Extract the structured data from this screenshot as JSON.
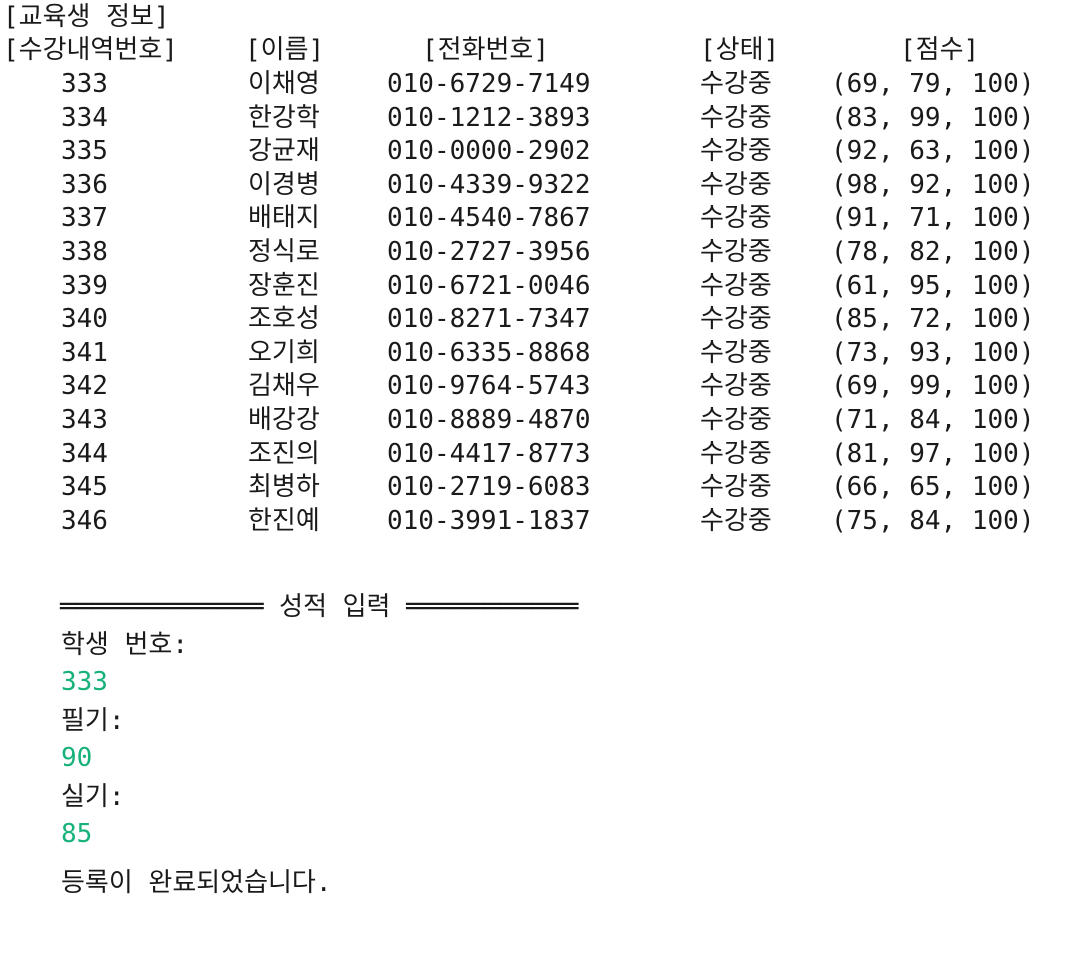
{
  "section_title": "[교육생 정보]",
  "columns": {
    "record_no": "[수강내역번호]",
    "name": "[이름]",
    "phone": "[전화번호]",
    "status": "[상태]",
    "score": "[점수]"
  },
  "rows": [
    {
      "no": "333",
      "name": "이채영",
      "phone": "010-6729-7149",
      "status": "수강중",
      "score": "(69, 79, 100)"
    },
    {
      "no": "334",
      "name": "한강학",
      "phone": "010-1212-3893",
      "status": "수강중",
      "score": "(83, 99, 100)"
    },
    {
      "no": "335",
      "name": "강균재",
      "phone": "010-0000-2902",
      "status": "수강중",
      "score": "(92, 63, 100)"
    },
    {
      "no": "336",
      "name": "이경병",
      "phone": "010-4339-9322",
      "status": "수강중",
      "score": "(98, 92, 100)"
    },
    {
      "no": "337",
      "name": "배태지",
      "phone": "010-4540-7867",
      "status": "수강중",
      "score": "(91, 71, 100)"
    },
    {
      "no": "338",
      "name": "정식로",
      "phone": "010-2727-3956",
      "status": "수강중",
      "score": "(78, 82, 100)"
    },
    {
      "no": "339",
      "name": "장훈진",
      "phone": "010-6721-0046",
      "status": "수강중",
      "score": "(61, 95, 100)"
    },
    {
      "no": "340",
      "name": "조호성",
      "phone": "010-8271-7347",
      "status": "수강중",
      "score": "(85, 72, 100)"
    },
    {
      "no": "341",
      "name": "오기희",
      "phone": "010-6335-8868",
      "status": "수강중",
      "score": "(73, 93, 100)"
    },
    {
      "no": "342",
      "name": "김채우",
      "phone": "010-9764-5743",
      "status": "수강중",
      "score": "(69, 99, 100)"
    },
    {
      "no": "343",
      "name": "배강강",
      "phone": "010-8889-4870",
      "status": "수강중",
      "score": "(71, 84, 100)"
    },
    {
      "no": "344",
      "name": "조진의",
      "phone": "010-4417-8773",
      "status": "수강중",
      "score": "(81, 97, 100)"
    },
    {
      "no": "345",
      "name": "최병하",
      "phone": "010-2719-6083",
      "status": "수강중",
      "score": "(66, 65, 100)"
    },
    {
      "no": "346",
      "name": "한진예",
      "phone": "010-3991-1837",
      "status": "수강중",
      "score": "(75, 84, 100)"
    }
  ],
  "grade_input": {
    "banner": "═════════════ 성적 입력 ═══════════",
    "student_no_prompt": "학생 번호:",
    "student_no_value": "333",
    "written_prompt": "필기:",
    "written_value": "90",
    "practical_prompt": "실기:",
    "practical_value": "85",
    "done_message": "등록이 완료되었습니다."
  },
  "colors": {
    "input_text": "#16b27a",
    "output_text": "#1a1a1a"
  }
}
